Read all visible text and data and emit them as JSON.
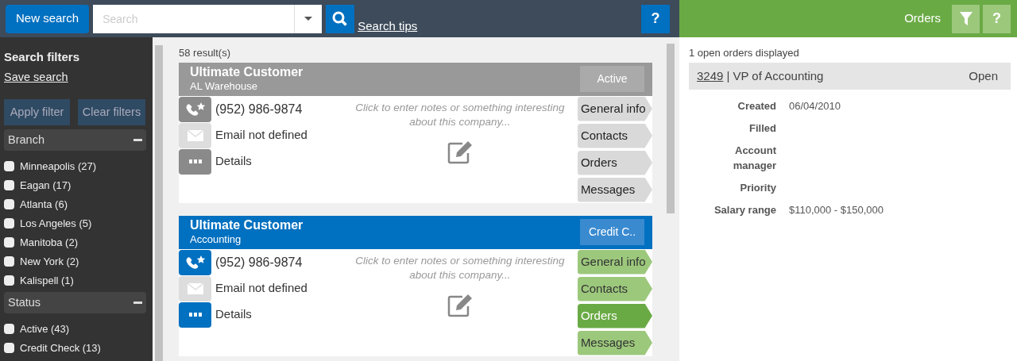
{
  "toolbar": {
    "new_search": "New search",
    "search": {
      "placeholder": "Search"
    },
    "search_tips": "Search tips",
    "help": "?"
  },
  "sidebar": {
    "title": "Search filters",
    "save_search": "Save search",
    "apply": "Apply filter",
    "clear": "Clear filters",
    "groups": [
      {
        "title": "Branch",
        "expanded": true,
        "items": [
          {
            "label": "Minneapolis (27)",
            "checked": false
          },
          {
            "label": "Eagan (17)",
            "checked": false
          },
          {
            "label": "Atlanta (6)",
            "checked": false
          },
          {
            "label": "Los Angeles (5)",
            "checked": false
          },
          {
            "label": "Manitoba (2)",
            "checked": false
          },
          {
            "label": "New York (2)",
            "checked": false
          },
          {
            "label": "Kalispell (1)",
            "checked": false
          }
        ]
      },
      {
        "title": "Status",
        "expanded": true,
        "items": [
          {
            "label": "Active (43)",
            "checked": false
          },
          {
            "label": "Credit Check (13)",
            "checked": false
          }
        ]
      }
    ]
  },
  "results": {
    "count": "58 result(s)",
    "cards": [
      {
        "name": "Ultimate Customer",
        "subtitle": "AL Warehouse",
        "status": "Active",
        "selected": false,
        "contacts": [
          {
            "kind": "phone",
            "text": "(952) 986-9874",
            "disabled": false
          },
          {
            "kind": "email",
            "text": "Email not defined",
            "disabled": true
          },
          {
            "kind": "details",
            "text": "Details",
            "disabled": false
          }
        ],
        "notes": "Click to enter notes or something interesting about this company...",
        "tabs": [
          {
            "label": "General info",
            "selected": false
          },
          {
            "label": "Contacts",
            "selected": false
          },
          {
            "label": "Orders",
            "selected": false
          },
          {
            "label": "Messages",
            "selected": false
          }
        ]
      },
      {
        "name": "Ultimate Customer",
        "subtitle": "Accounting",
        "status": "Credit C..",
        "selected": true,
        "contacts": [
          {
            "kind": "phone",
            "text": "(952) 986-9874",
            "disabled": false
          },
          {
            "kind": "email",
            "text": "Email not defined",
            "disabled": true
          },
          {
            "kind": "details",
            "text": "Details",
            "disabled": false
          }
        ],
        "notes": "Click to enter notes or something interesting about this company...",
        "tabs": [
          {
            "label": "General info",
            "selected": false
          },
          {
            "label": "Contacts",
            "selected": false
          },
          {
            "label": "Orders",
            "selected": true
          },
          {
            "label": "Messages",
            "selected": false
          }
        ]
      }
    ]
  },
  "orders_panel": {
    "title": "Orders",
    "help": "?",
    "summary": "1 open orders displayed",
    "order": {
      "number": "3249",
      "title": "| VP of Accounting",
      "status": "Open",
      "fields": [
        {
          "label": "Created",
          "value": "06/04/2010"
        },
        {
          "label": "Filled"
        },
        {
          "label": "Account manager"
        },
        {
          "label": "Priority"
        },
        {
          "label": "Salary range",
          "value": "$110,000 - $150,000"
        }
      ]
    }
  }
}
